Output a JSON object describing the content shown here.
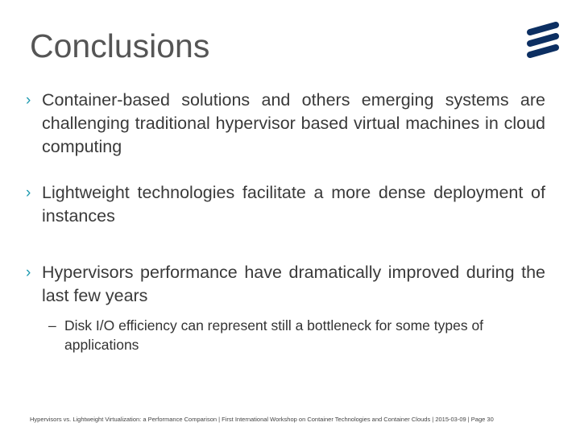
{
  "slide": {
    "title": "Conclusions",
    "logo": "ericsson-logo-icon",
    "bullets": [
      {
        "marker": "›",
        "text": "Container-based solutions and others emerging systems are challenging traditional hypervisor based virtual machines in cloud computing"
      },
      {
        "marker": "›",
        "text": "Lightweight technologies facilitate a more dense deployment of instances"
      },
      {
        "marker": "›",
        "text": "Hypervisors performance have dramatically improved during the last few years",
        "sub": [
          {
            "marker": "–",
            "text": "Disk I/O efficiency can represent still a bottleneck for some types of applications"
          }
        ]
      }
    ],
    "footer": "Hypervisors vs. Lightweight Virtualization: a Performance Comparison | First International Workshop on Container Technologies and Container Clouds | 2015-03-09 | Page 30"
  },
  "colors": {
    "title": "#555555",
    "marker": "#1e9ab0",
    "logo": "#0c2f62"
  }
}
